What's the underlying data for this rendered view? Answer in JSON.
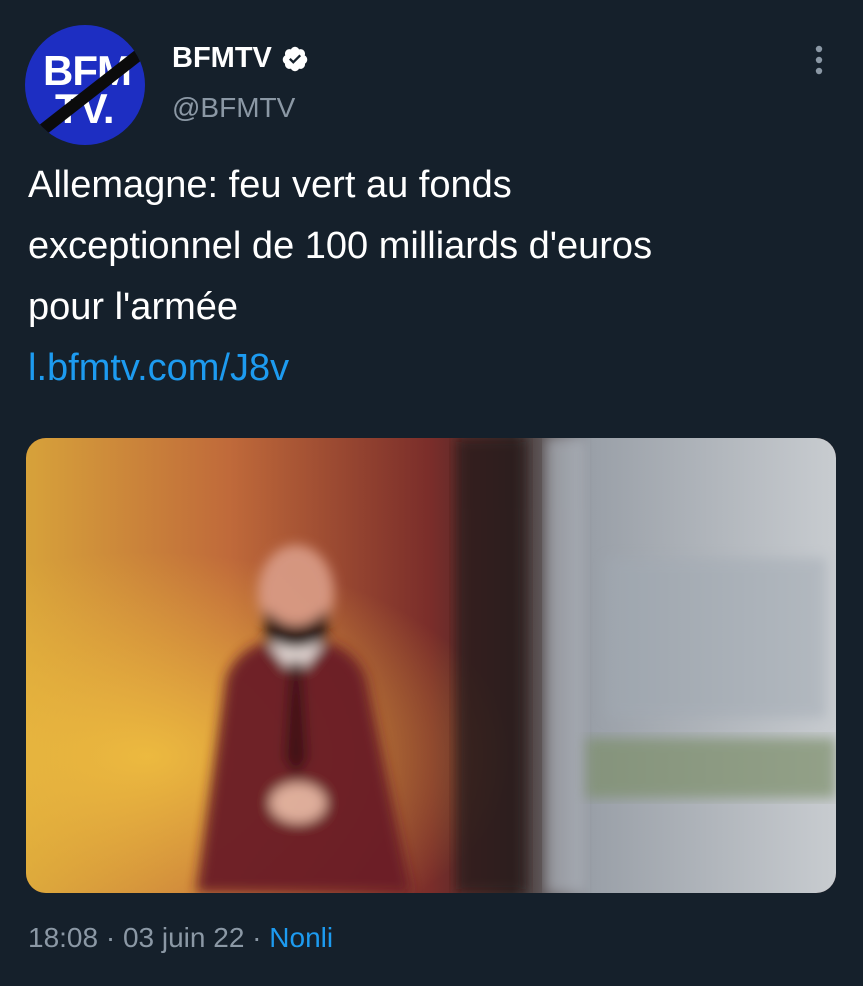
{
  "author": {
    "display_name": "BFMTV",
    "handle": "@BFMTV",
    "avatar_text_line1": "BFM",
    "avatar_text_line2": "TV.",
    "verified": true,
    "avatar_color": "#1d2ec2"
  },
  "tweet": {
    "text_lines": [
      "Allemagne: feu vert au fonds",
      "exceptionnel de 100 milliards d'euros",
      "pour l'armée"
    ],
    "link": "l.bfmtv.com/J8v"
  },
  "meta": {
    "time": "18:08",
    "sep1": " · ",
    "date": "03 juin 22",
    "sep2": " · ",
    "app": "Nonli"
  },
  "colors": {
    "background": "#15202b",
    "link": "#1d9bf0",
    "muted": "#8b98a5"
  },
  "icons": [
    "verified-badge-icon",
    "more-options-icon"
  ]
}
